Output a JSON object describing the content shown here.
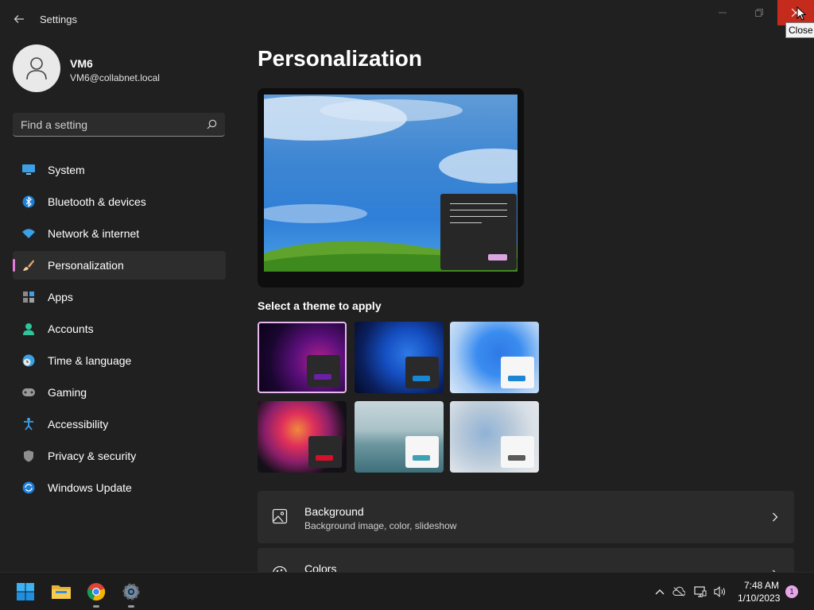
{
  "window": {
    "title": "Settings",
    "close_tooltip": "Close"
  },
  "user": {
    "name": "VM6",
    "email": "VM6@collabnet.local"
  },
  "search": {
    "placeholder": "Find a setting"
  },
  "sidebar": {
    "items": [
      {
        "label": "System",
        "icon": "monitor-icon"
      },
      {
        "label": "Bluetooth & devices",
        "icon": "bluetooth-icon"
      },
      {
        "label": "Network & internet",
        "icon": "wifi-icon"
      },
      {
        "label": "Personalization",
        "icon": "brush-icon",
        "active": true
      },
      {
        "label": "Apps",
        "icon": "apps-icon"
      },
      {
        "label": "Accounts",
        "icon": "person-icon"
      },
      {
        "label": "Time & language",
        "icon": "clock-globe-icon"
      },
      {
        "label": "Gaming",
        "icon": "gamepad-icon"
      },
      {
        "label": "Accessibility",
        "icon": "accessibility-icon"
      },
      {
        "label": "Privacy & security",
        "icon": "shield-icon"
      },
      {
        "label": "Windows Update",
        "icon": "update-icon"
      }
    ]
  },
  "main": {
    "page_title": "Personalization",
    "theme_section_label": "Select a theme to apply",
    "themes": [
      {
        "name": "windows-dark-glow",
        "selected": true,
        "accent": "#6b1fa6"
      },
      {
        "name": "windows-dark-bloom",
        "accent": "#1a86d4"
      },
      {
        "name": "windows-light-bloom",
        "accent": "#1a86d4"
      },
      {
        "name": "glow",
        "accent": "#d4102a"
      },
      {
        "name": "captured-motion",
        "accent": "#3ea2b4"
      },
      {
        "name": "flow",
        "accent": "#5a5a5a"
      }
    ],
    "cards": [
      {
        "title": "Background",
        "subtitle": "Background image, color, slideshow",
        "icon": "image-icon"
      },
      {
        "title": "Colors",
        "subtitle": "",
        "icon": "palette-icon"
      }
    ]
  },
  "taskbar": {
    "time": "7:48 AM",
    "date": "1/10/2023",
    "notification_count": "1"
  },
  "colors": {
    "accent": "#e47bd8",
    "close_red": "#c42b1c"
  }
}
